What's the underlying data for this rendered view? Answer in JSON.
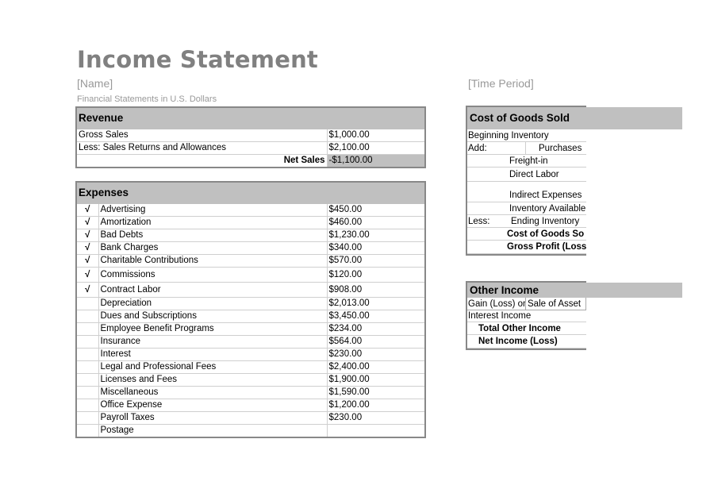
{
  "header": {
    "title": "Income Statement",
    "name": "[Name]",
    "time_period": "[Time Period]",
    "subtitle": "Financial Statements in U.S. Dollars"
  },
  "revenue": {
    "heading": "Revenue",
    "rows": [
      {
        "label": "Gross Sales",
        "value": "$1,000.00"
      },
      {
        "label": "Less: Sales Returns and Allowances",
        "value": "$2,100.00"
      }
    ],
    "net_sales_label": "Net Sales",
    "net_sales_value": "-$1,100.00"
  },
  "expenses": {
    "heading": "Expenses",
    "check_glyph": "√",
    "rows": [
      {
        "checked": true,
        "label": "Advertising",
        "value": "$450.00"
      },
      {
        "checked": true,
        "label": "Amortization",
        "value": "$460.00"
      },
      {
        "checked": true,
        "label": "Bad Debts",
        "value": "$1,230.00"
      },
      {
        "checked": true,
        "label": "Bank Charges",
        "value": "$340.00"
      },
      {
        "checked": true,
        "label": "Charitable Contributions",
        "value": "$570.00"
      },
      {
        "checked": true,
        "label": "Commissions",
        "value": "$120.00"
      },
      {
        "checked": true,
        "label": "Contract Labor",
        "value": "$908.00"
      },
      {
        "checked": false,
        "label": "Depreciation",
        "value": "$2,013.00"
      },
      {
        "checked": false,
        "label": "Dues and Subscriptions",
        "value": "$3,450.00"
      },
      {
        "checked": false,
        "label": "Employee Benefit Programs",
        "value": "$234.00"
      },
      {
        "checked": false,
        "label": "Insurance",
        "value": "$564.00"
      },
      {
        "checked": false,
        "label": "Interest",
        "value": "$230.00"
      },
      {
        "checked": false,
        "label": "Legal and Professional Fees",
        "value": "$2,400.00"
      },
      {
        "checked": false,
        "label": "Licenses and Fees",
        "value": "$1,900.00"
      },
      {
        "checked": false,
        "label": "Miscellaneous",
        "value": "$1,590.00"
      },
      {
        "checked": false,
        "label": "Office Expense",
        "value": "$1,200.00"
      },
      {
        "checked": false,
        "label": "Payroll Taxes",
        "value": "$230.00"
      },
      {
        "checked": false,
        "label": "Postage",
        "value": ""
      }
    ]
  },
  "cogs": {
    "heading": "Cost of Goods Sold",
    "beginning_inventory": "Beginning Inventory",
    "add_label": "Add:",
    "purchases": "Purchases",
    "freight_in": "Freight-in",
    "direct_labor": "Direct Labor",
    "indirect_expenses": "Indirect Expenses",
    "inventory_available": "Inventory Available",
    "less_label": "Less:",
    "ending_inventory": "Ending Inventory",
    "cost_of_goods_sold": "Cost of Goods So",
    "gross_profit": "Gross Profit (Loss"
  },
  "other_income": {
    "heading": "Other Income",
    "gain_loss_a": "Gain (Loss) on",
    "gain_loss_b": "Sale of Asset",
    "interest_income": "Interest Income",
    "total_other_income": "Total Other Income",
    "net_income": "Net Income (Loss)"
  }
}
